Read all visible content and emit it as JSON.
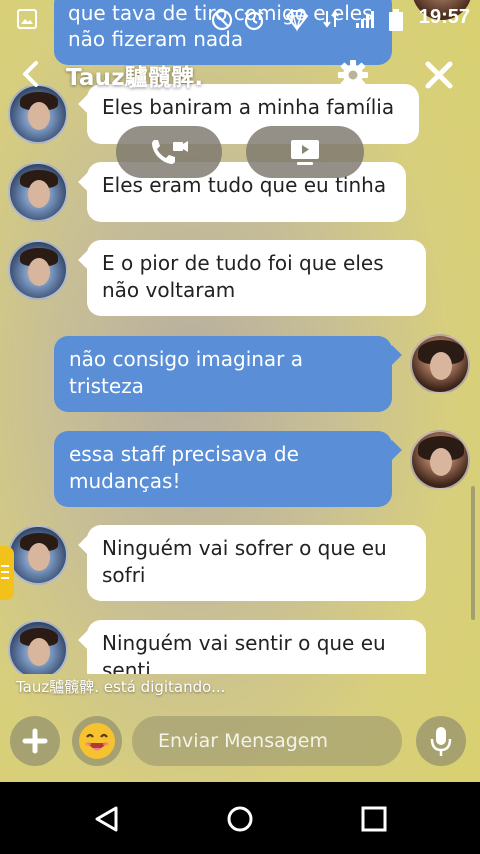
{
  "status_bar": {
    "time": "19:57"
  },
  "header": {
    "title": "Tauz驢髖髀."
  },
  "top_message": {
    "text": "que tava de tiro comigo e eles não fizeram nada"
  },
  "messages": [
    {
      "side": "in",
      "text": "Eles baniram a minha família"
    },
    {
      "side": "in",
      "text": "Eles eram tudo que eu tinha"
    },
    {
      "side": "in",
      "text": "E o pior de tudo foi que eles não voltaram"
    },
    {
      "side": "out",
      "text": "não consigo imaginar a tristeza"
    },
    {
      "side": "out",
      "text": "essa staff precisava de mudanças!"
    },
    {
      "side": "in",
      "text": "Ninguém vai sofrer o que eu sofri"
    },
    {
      "side": "in",
      "text": "Ninguém vai sentir o que eu senti"
    }
  ],
  "typing_indicator": "Tauz驢髖髀. está digitando...",
  "composer": {
    "placeholder": "Enviar Mensagem"
  },
  "colors": {
    "outgoing_bubble": "#5a8fd8",
    "incoming_bubble": "#ffffff",
    "side_handle": "#f2c21b"
  }
}
